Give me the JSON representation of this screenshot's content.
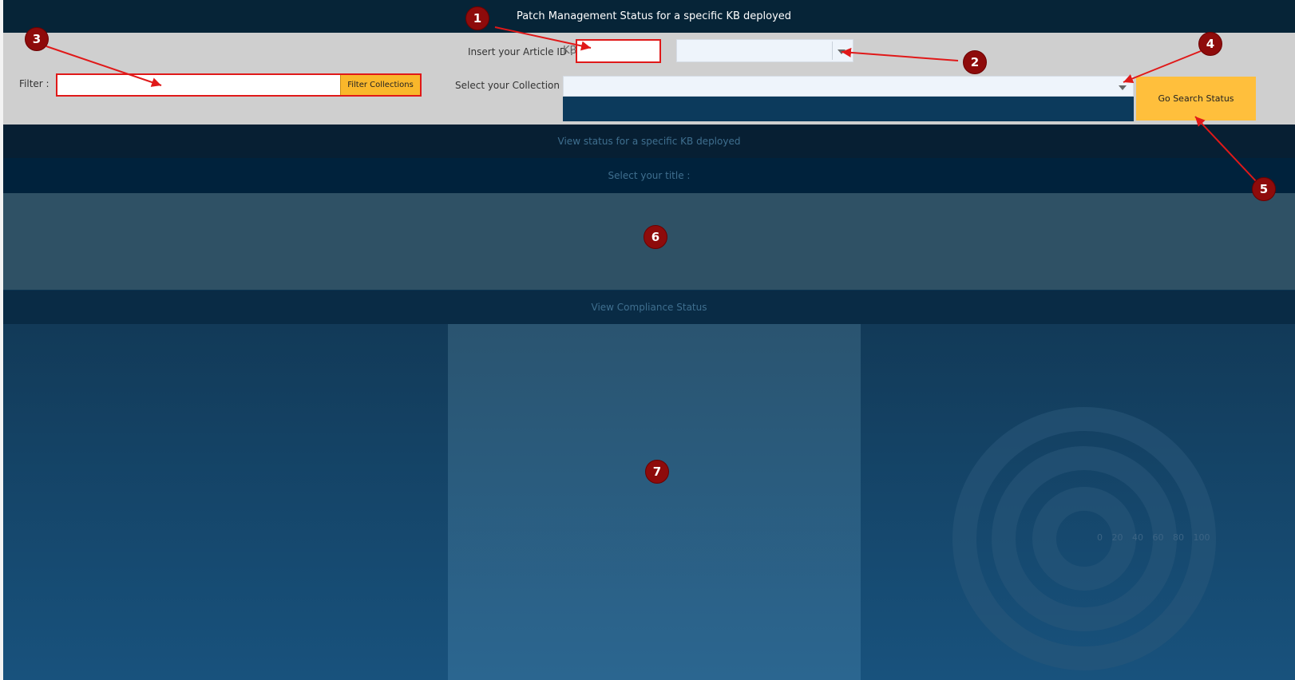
{
  "app": {
    "title": "Patch Management Status for a specific KB deployed"
  },
  "controls": {
    "article_label": "Insert your Article ID :",
    "kb_prefix": "KB",
    "article_value": "",
    "filter_label": "Filter :",
    "filter_value": "",
    "filter_button": "Filter Collections",
    "collection_label": "Select your Collection :",
    "collection_value": "",
    "go_button": "Go Search Status"
  },
  "sections": {
    "view_kb": "View status for a specific KB deployed",
    "select_title": "Select your title :",
    "compliance": "View Compliance Status"
  },
  "gauge": {
    "ticks": "0 20 40 60 80 100"
  },
  "annotations": [
    "1",
    "2",
    "3",
    "4",
    "5",
    "6",
    "7"
  ],
  "colors": {
    "title_bar": "#062437",
    "controls_bg": "#cfcfcf",
    "button_accent": "#f9b72b",
    "annotation": "#8e0b0b",
    "arrow": "#e01919"
  }
}
